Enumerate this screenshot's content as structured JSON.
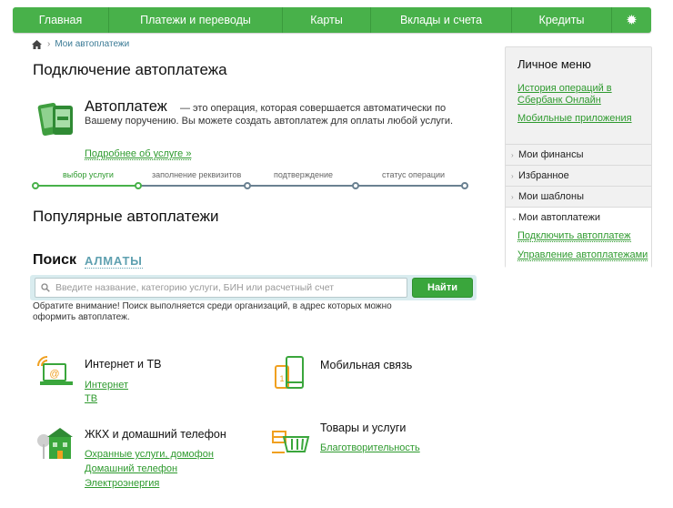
{
  "nav": {
    "items": [
      "Главная",
      "Платежи и переводы",
      "Карты",
      "Вклады и счета",
      "Кредиты"
    ],
    "settings_icon": "gear-icon"
  },
  "breadcrumb": {
    "home_icon": "home-icon",
    "link": "Мои автоплатежи"
  },
  "page_title": "Подключение автоплатежа",
  "promo": {
    "icon": "phone-card-icon",
    "heading": "Автоплатеж",
    "desc_line1": "— это операция, которая совершается автоматически по",
    "desc_line2": "Вашему поручению. Вы можете создать автоплатеж для оплаты любой услуги.",
    "link": "Подробнее об услуге »"
  },
  "steps": {
    "labels": [
      "выбор услуги",
      "заполнение реквизитов",
      "подтверждение",
      "статус операции"
    ],
    "active_index": 0,
    "colors": {
      "active": "#48b14a",
      "inactive": "#6a8191"
    }
  },
  "popular_title": "Популярные автоплатежи",
  "search": {
    "title": "Поиск",
    "city": "АЛМАТЫ",
    "placeholder": "Введите название, категорию услуги, БИН или расчетный счет",
    "button": "Найти",
    "note": "Обратите внимание! Поиск выполняется среди организаций, в адрес которых можно оформить автоплатеж."
  },
  "categories": [
    {
      "icon": "laptop-wifi-icon",
      "title": "Интернет и ТВ",
      "links": [
        "Интернет",
        "ТВ"
      ]
    },
    {
      "icon": "mobile-phone-icon",
      "title": "Мобильная связь",
      "links": []
    },
    {
      "icon": "house-tree-icon",
      "title": "ЖКХ и домашний телефон",
      "links": [
        "Охранные услуги, домофон",
        "Домашний телефон",
        "Электроэнергия"
      ]
    },
    {
      "icon": "shopping-basket-icon",
      "title": "Товары и услуги",
      "links": [
        "Благотворительность"
      ]
    }
  ],
  "sidebar": {
    "title": "Личное меню",
    "links": [
      "История операций в Сбербанк Онлайн",
      "Мобильные приложения"
    ],
    "sections": [
      "Мои финансы",
      "Избранное",
      "Мои шаблоны",
      "Мои автоплатежи"
    ],
    "open_section_links": [
      "Подключить автоплатеж",
      "Управление автоплатежами"
    ]
  },
  "colors": {
    "brand_green": "#48b14a",
    "link_green": "#2e9a2e",
    "link_blue": "#3a7a95"
  }
}
